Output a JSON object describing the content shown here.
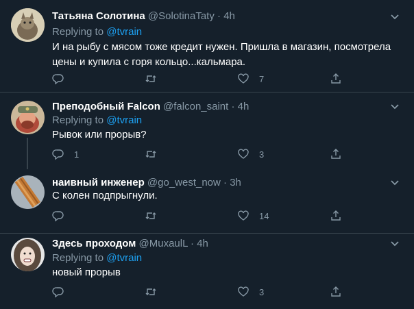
{
  "tweets": [
    {
      "name": "Татьяна Солотина",
      "handle": "@SolotinaTaty",
      "dot": "·",
      "time": "4h",
      "replying_prefix": "Replying to",
      "replying_to": "@tvrain",
      "text": "И на рыбу с мясом тоже кредит нужен. Пришла в магазин, посмотрела цены и купила с горя кольцо...кальмара.",
      "replies": "",
      "retweets": "",
      "likes": "7"
    },
    {
      "name": "Преподобный Falcon",
      "handle": "@falcon_saint",
      "dot": "·",
      "time": "4h",
      "replying_prefix": "Replying to",
      "replying_to": "@tvrain",
      "text": "Рывок или прорыв?",
      "replies": "1",
      "retweets": "",
      "likes": "3"
    },
    {
      "name": "наивный инженер",
      "handle": "@go_west_now",
      "dot": "·",
      "time": "3h",
      "text": "С колен подпрыгнули.",
      "replies": "",
      "retweets": "",
      "likes": "14"
    },
    {
      "name": "Здесь проходом",
      "handle": "@MuxaulL",
      "dot": "·",
      "time": "4h",
      "replying_prefix": "Replying to",
      "replying_to": "@tvrain",
      "text": "новый прорыв",
      "replies": "",
      "retweets": "",
      "likes": "3"
    }
  ],
  "colors": {
    "background": "#15202b",
    "separator": "#38444d",
    "secondary_text": "#8899a6",
    "link": "#1da1f2"
  },
  "icons": [
    "reply-icon",
    "retweet-icon",
    "like-icon",
    "share-icon",
    "chevron-down-icon"
  ]
}
